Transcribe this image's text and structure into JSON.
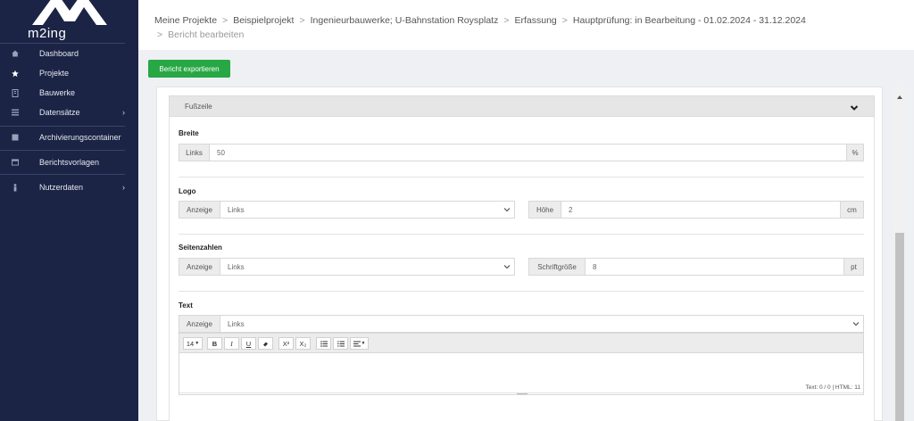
{
  "app": {
    "logo_text": "m2ing"
  },
  "sidebar": {
    "items": [
      {
        "label": "Dashboard",
        "icon": "home-icon",
        "has_children": false
      },
      {
        "label": "Projekte",
        "icon": "star-icon",
        "has_children": false
      },
      {
        "label": "Bauwerke",
        "icon": "building-icon",
        "has_children": false
      },
      {
        "label": "Datensätze",
        "icon": "list-icon",
        "has_children": true
      },
      {
        "label": "Archivierungscontainer",
        "icon": "archive-icon",
        "has_children": false
      },
      {
        "label": "Berichtsvorlagen",
        "icon": "template-icon",
        "has_children": false
      },
      {
        "label": "Nutzerdaten",
        "icon": "user-icon",
        "has_children": true
      }
    ]
  },
  "breadcrumb": {
    "items": [
      "Meine Projekte",
      "Beispielprojekt",
      "Ingenieurbauwerke; U-Bahnstation Roysplatz",
      "Erfassung",
      "Hauptprüfung: in Bearbeitung - 01.02.2024 - 31.12.2024"
    ],
    "current": "Bericht bearbeiten",
    "separator": ">"
  },
  "toolbar": {
    "export_label": "Bericht exportieren"
  },
  "panel": {
    "title": "Fußzeile",
    "breite": {
      "label": "Breite",
      "prefix": "Links",
      "value": "50",
      "suffix": "%"
    },
    "logo": {
      "label": "Logo",
      "anzeige_label": "Anzeige",
      "anzeige_value": "Links",
      "hoehe_label": "Höhe",
      "hoehe_value": "2",
      "hoehe_unit": "cm"
    },
    "seitenzahlen": {
      "label": "Seitenzahlen",
      "anzeige_label": "Anzeige",
      "anzeige_value": "Links",
      "schrift_label": "Schriftgröße",
      "schrift_value": "8",
      "schrift_unit": "pt"
    },
    "text": {
      "label": "Text",
      "anzeige_label": "Anzeige",
      "anzeige_value": "Links",
      "editor": {
        "font_size": "14",
        "bold": "B",
        "italic": "I",
        "underline": "U",
        "eraser": "⌫",
        "superscript": "X²",
        "subscript": "X₂",
        "status": "Text: 0 / 0 | HTML: 11"
      }
    }
  },
  "colors": {
    "sidebar_bg": "#1c2446",
    "accent_green": "#28a745"
  }
}
